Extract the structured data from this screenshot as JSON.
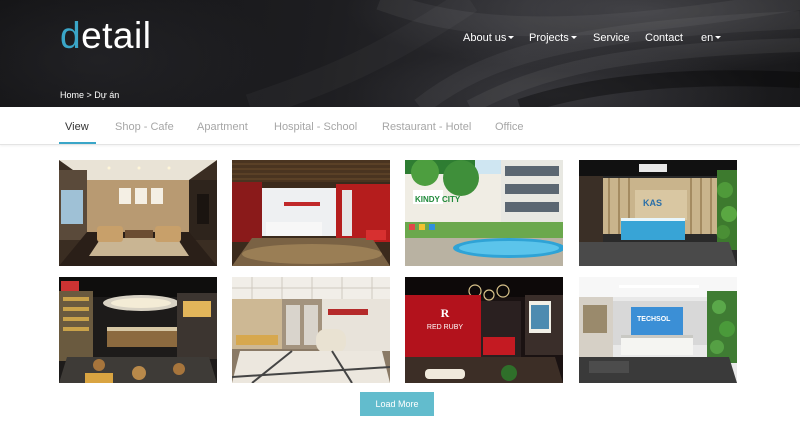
{
  "header": {
    "logo_first_letter": "d",
    "logo_rest": "etail",
    "nav": [
      {
        "label": "About us",
        "has_dropdown": true
      },
      {
        "label": "Projects",
        "has_dropdown": true
      },
      {
        "label": "Service",
        "has_dropdown": false
      },
      {
        "label": "Contact",
        "has_dropdown": false
      },
      {
        "label": "en",
        "has_dropdown": true
      }
    ],
    "breadcrumb": "Home > Dự án"
  },
  "tabs": {
    "items": [
      "View",
      "Shop - Cafe",
      "Apartment",
      "Hospital - School",
      "Restaurant - Hotel",
      "Office"
    ],
    "active_index": 0
  },
  "gallery": {
    "tiles": [
      {
        "scene": "lounge-interior",
        "sign": ""
      },
      {
        "scene": "red-lobby",
        "sign": ""
      },
      {
        "scene": "school-pool",
        "sign": "KINDY CITY"
      },
      {
        "scene": "office-reception",
        "sign": "KAS"
      },
      {
        "scene": "cafe-food-court",
        "sign": ""
      },
      {
        "scene": "marble-lobby",
        "sign": ""
      },
      {
        "scene": "red-ruby-lounge",
        "sign": "RED RUBY"
      },
      {
        "scene": "blue-reception",
        "sign": "TECHSOL"
      }
    ]
  },
  "load_more_label": "Load More",
  "colors": {
    "brand_accent": "#3aa6c8",
    "load_more_bg": "#62bccd",
    "header_bg": "#1b1b1e",
    "tab_inactive": "#a6a6a6",
    "tab_active": "#333333"
  }
}
